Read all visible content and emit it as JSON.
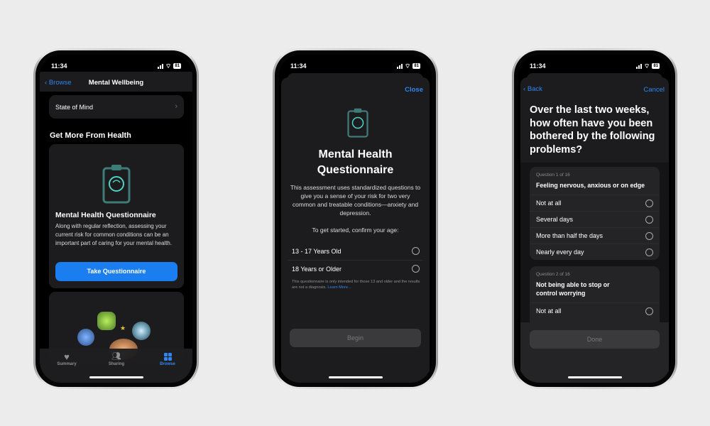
{
  "status": {
    "time": "11:34",
    "battery": "81"
  },
  "screen1": {
    "nav": {
      "back": "Browse",
      "title": "Mental Wellbeing"
    },
    "state_of_mind": "State of Mind",
    "section_title": "Get More From Health",
    "promo": {
      "title": "Mental Health Questionnaire",
      "body": "Along with regular reflection, assessing your current risk for common conditions can be an important part of caring for your mental health.",
      "button": "Take Questionnaire"
    },
    "tabs": [
      {
        "label": "Summary",
        "icon": "heart-icon"
      },
      {
        "label": "Sharing",
        "icon": "people-icon"
      },
      {
        "label": "Browse",
        "icon": "grid-icon",
        "active": true
      }
    ]
  },
  "screen2": {
    "close": "Close",
    "title": "Mental Health Questionnaire",
    "body": "This assessment uses standardized questions to give you a sense of your risk for two very common and treatable conditions—anxiety and depression.",
    "prompt": "To get started, confirm your age:",
    "options": [
      "13 - 17 Years Old",
      "18 Years or Older"
    ],
    "note": "This questionnaire is only intended for those 13 and older and the results are not a diagnosis.",
    "learn_more": "Learn More...",
    "begin": "Begin"
  },
  "screen3": {
    "back": "Back",
    "cancel": "Cancel",
    "title": "Over the last two weeks, how often have you been bothered by the following problems?",
    "questions": [
      {
        "label": "Question 1 of 16",
        "text": "Feeling nervous, anxious or on edge",
        "options": [
          "Not at all",
          "Several days",
          "More than half the days",
          "Nearly every day"
        ]
      },
      {
        "label": "Question 2 of 16",
        "text": "Not being able to stop or control worrying",
        "options": [
          "Not at all"
        ]
      }
    ],
    "done": "Done"
  },
  "colors": {
    "accent": "#2f86f0",
    "teal": "#4fd1c5",
    "background": "#ececec"
  }
}
